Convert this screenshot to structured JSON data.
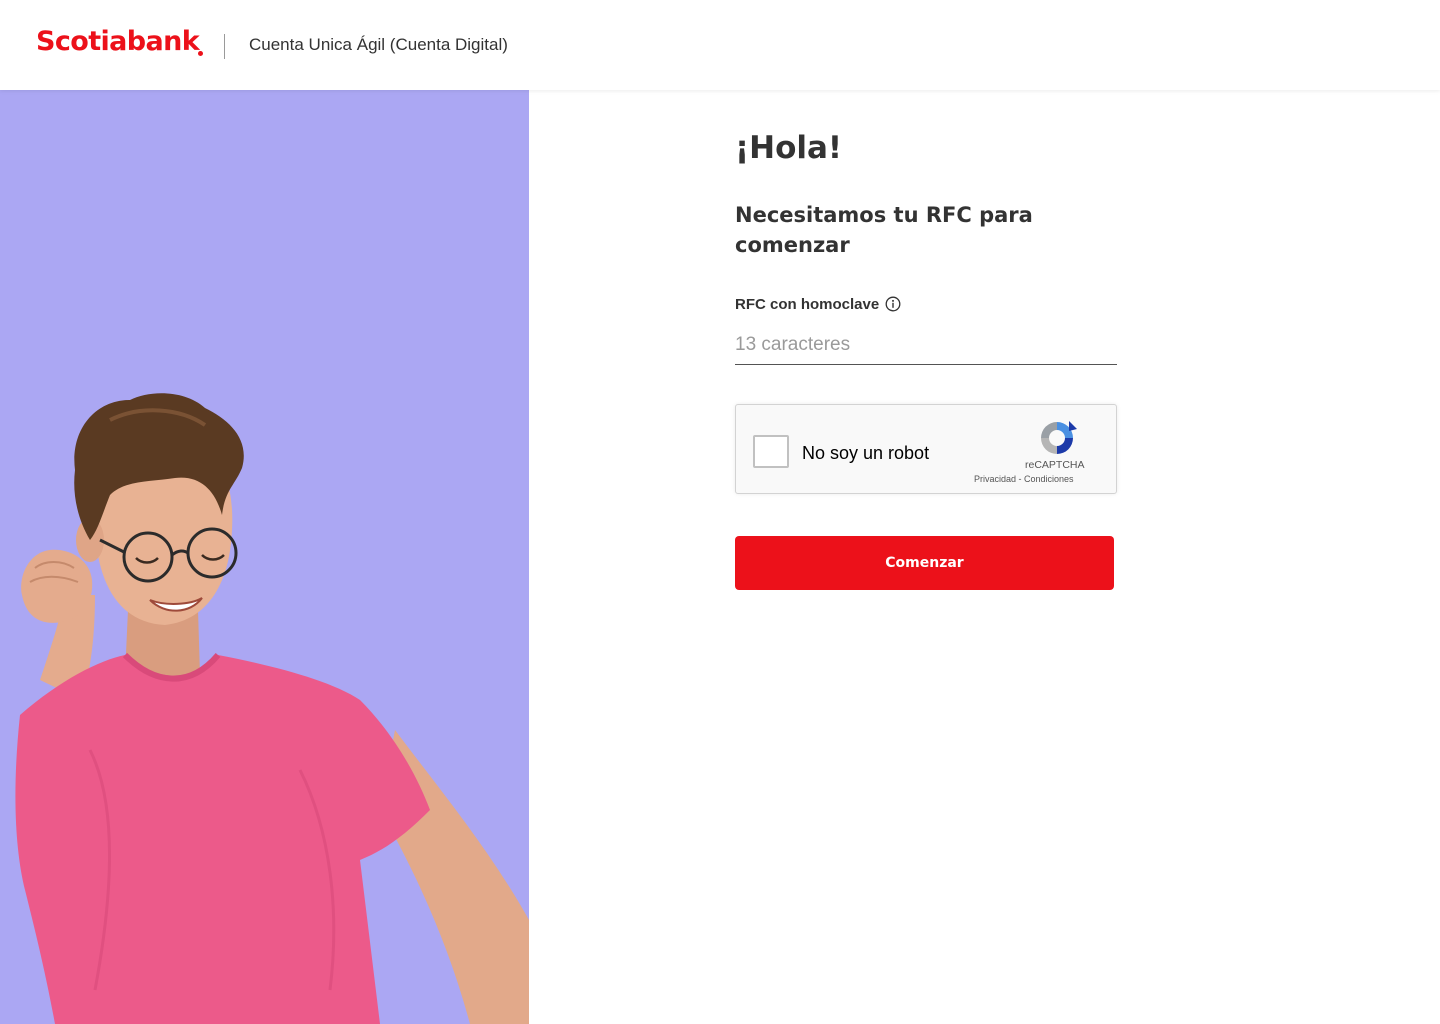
{
  "header": {
    "logo_text": "Scotiabank",
    "product_title": "Cuenta Unica Ágil (Cuenta Digital)"
  },
  "hero": {
    "image": "smiling-man-pink-tshirt-celebrating",
    "background_color": "#aba7f3"
  },
  "form": {
    "greeting": "¡Hola!",
    "subtitle": "Necesitamos tu RFC para comenzar",
    "rfc_label": "RFC con homoclave",
    "rfc_info_icon": "info-icon",
    "rfc_placeholder": "13 caracteres",
    "rfc_value": "",
    "captcha": {
      "label": "No soy un robot",
      "brand": "reCAPTCHA",
      "privacy": "Privacidad",
      "separator": " - ",
      "terms": "Condiciones",
      "checked": false
    },
    "submit_label": "Comenzar"
  },
  "colors": {
    "brand_red": "#ec111a",
    "text": "#333333",
    "hero_background": "#aba7f3",
    "shirt": "#ec5a8a"
  }
}
